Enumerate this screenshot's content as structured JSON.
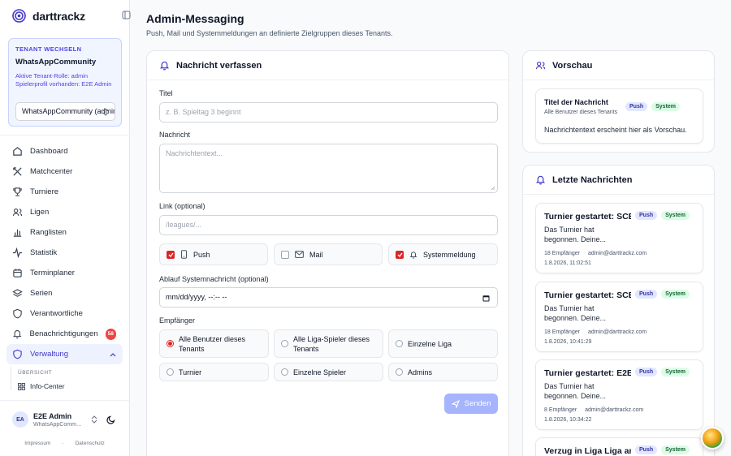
{
  "brand": {
    "name": "darttrackz"
  },
  "tenant": {
    "heading": "TENANT WECHSELN",
    "name": "WhatsAppCommunity",
    "role": "Aktive Tenant-Rolle: admin",
    "profile": "Spielerprofil vorhanden: E2E Admin",
    "select_value": "WhatsAppCommunity (admin)"
  },
  "nav": [
    {
      "label": "Dashboard",
      "icon": "dashboard-icon"
    },
    {
      "label": "Matchcenter",
      "icon": "darts-icon"
    },
    {
      "label": "Turniere",
      "icon": "trophy-icon"
    },
    {
      "label": "Ligen",
      "icon": "users-icon"
    },
    {
      "label": "Ranglisten",
      "icon": "bar-chart-icon"
    },
    {
      "label": "Statistik",
      "icon": "activity-icon"
    },
    {
      "label": "Terminplaner",
      "icon": "calendar-icon"
    },
    {
      "label": "Serien",
      "icon": "layers-icon"
    },
    {
      "label": "Verantwortliche",
      "icon": "shield-icon"
    },
    {
      "label": "Benachrichtigungen",
      "icon": "bell-icon",
      "badge": "58"
    },
    {
      "label": "Verwaltung",
      "icon": "shield-icon",
      "active": true
    }
  ],
  "subnav": {
    "heading": "ÜBERSICHT",
    "items": [
      {
        "label": "Info-Center"
      }
    ]
  },
  "user": {
    "initials": "EA",
    "name": "E2E Admin",
    "tenant": "WhatsAppCommunity"
  },
  "footer": {
    "impressum": "Impressum",
    "datenschutz": "Datenschutz"
  },
  "page": {
    "title": "Admin-Messaging",
    "subtitle": "Push, Mail und Systemmeldungen an definierte Zielgruppen dieses Tenants."
  },
  "compose": {
    "heading": "Nachricht verfassen",
    "title_label": "Titel",
    "title_placeholder": "z. B. Spieltag 3 beginnt",
    "message_label": "Nachricht",
    "message_placeholder": "Nachrichtentext...",
    "link_label": "Link (optional)",
    "link_placeholder": "/leagues/...",
    "channels": [
      {
        "label": "Push",
        "checked": true,
        "icon": "smartphone-icon"
      },
      {
        "label": "Mail",
        "checked": false,
        "icon": "mail-icon"
      },
      {
        "label": "Systemmeldung",
        "checked": true,
        "icon": "bell-icon"
      }
    ],
    "expiry_label": "Ablauf Systemnachricht (optional)",
    "expiry_value": "mm/dd/yyyy, --:-- --",
    "recipients_label": "Empfänger",
    "recipients": [
      {
        "label": "Alle Benutzer dieses Tenants",
        "selected": true
      },
      {
        "label": "Alle Liga-Spieler dieses Tenants",
        "selected": false
      },
      {
        "label": "Einzelne Liga",
        "selected": false
      },
      {
        "label": "Turnier",
        "selected": false
      },
      {
        "label": "Einzelne Spieler",
        "selected": false
      },
      {
        "label": "Admins",
        "selected": false
      }
    ],
    "send_label": "Senden"
  },
  "preview": {
    "heading": "Vorschau",
    "title": "Titel der Nachricht",
    "audience": "Alle Benutzer dieses Tenants",
    "text": "Nachrichtentext erscheint hier als Vorschau.",
    "tag_push": "Push",
    "tag_system": "System"
  },
  "recent": {
    "heading": "Letzte Nachrichten",
    "messages": [
      {
        "title": "Turnier gestartet: SCE",
        "body": "Das Turnier hat begonnen. Deine...",
        "recipients": "18 Empfänger",
        "author": "admin@darttrackz.com",
        "date": "1.8.2026, 11:02:51",
        "tag_push": "Push",
        "tag_system": "System"
      },
      {
        "title": "Turnier gestartet: SCE",
        "body": "Das Turnier hat begonnen. Deine...",
        "recipients": "18 Empfänger",
        "author": "admin@darttrackz.com",
        "date": "1.8.2026, 10:41:29",
        "tag_push": "Push",
        "tag_system": "System"
      },
      {
        "title": "Turnier gestartet: E2E",
        "body": "Das Turnier hat begonnen. Deine...",
        "recipients": "8 Empfänger",
        "author": "admin@darttrackz.com",
        "date": "1.8.2026, 10:34:22",
        "tag_push": "Push",
        "tag_system": "System"
      },
      {
        "title": "Verzug in Liga Liga am",
        "body": "",
        "recipients": "",
        "author": "",
        "date": "",
        "tag_push": "Push",
        "tag_system": "System"
      }
    ]
  }
}
